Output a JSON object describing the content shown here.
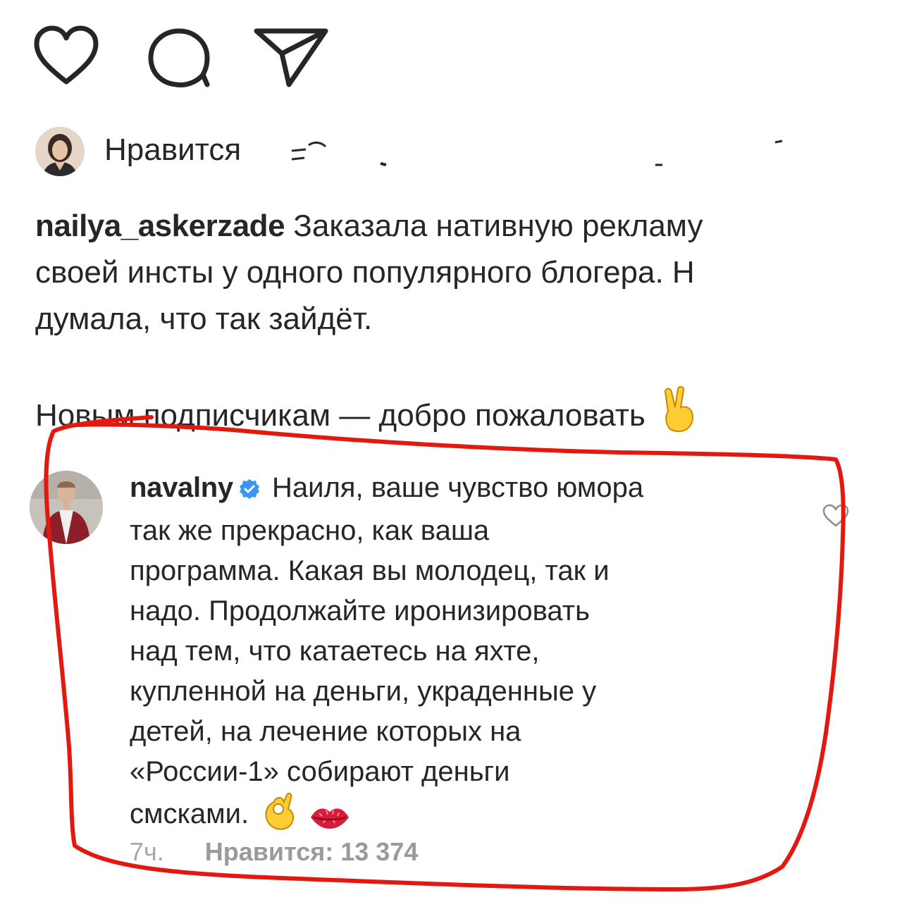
{
  "actions": {
    "like_icon": "heart-icon",
    "comment_icon": "comment-icon",
    "share_icon": "paper-plane-icon"
  },
  "likes": {
    "text": "Нравится"
  },
  "caption": {
    "username": "nailya_askerzade",
    "line1_rest": " Заказала нативную рекламу",
    "line2": "своей инсты у одного популярного блогера. Н",
    "line3": "думала, что так зайдёт.",
    "line4": "Новым подписчикам — добро пожаловать"
  },
  "comment": {
    "username": "navalny",
    "lines": [
      " Наиля, ваше чувство юмора",
      "так же прекрасно, как ваша",
      "программа. Какая вы молодец, так и",
      "надо. Продолжайте иронизировать",
      "над тем, что катаетесь на яхте,",
      "купленной на деньги, украденные у",
      "детей, на лечение которых на",
      "«России-1» собирают деньги",
      "смсками."
    ],
    "time": "7ч.",
    "likes_text": "Нравится: 13 374"
  },
  "colors": {
    "text": "#262626",
    "muted": "#a8a8a8",
    "verified": "#3897f0",
    "highlight": "#e3190f"
  }
}
